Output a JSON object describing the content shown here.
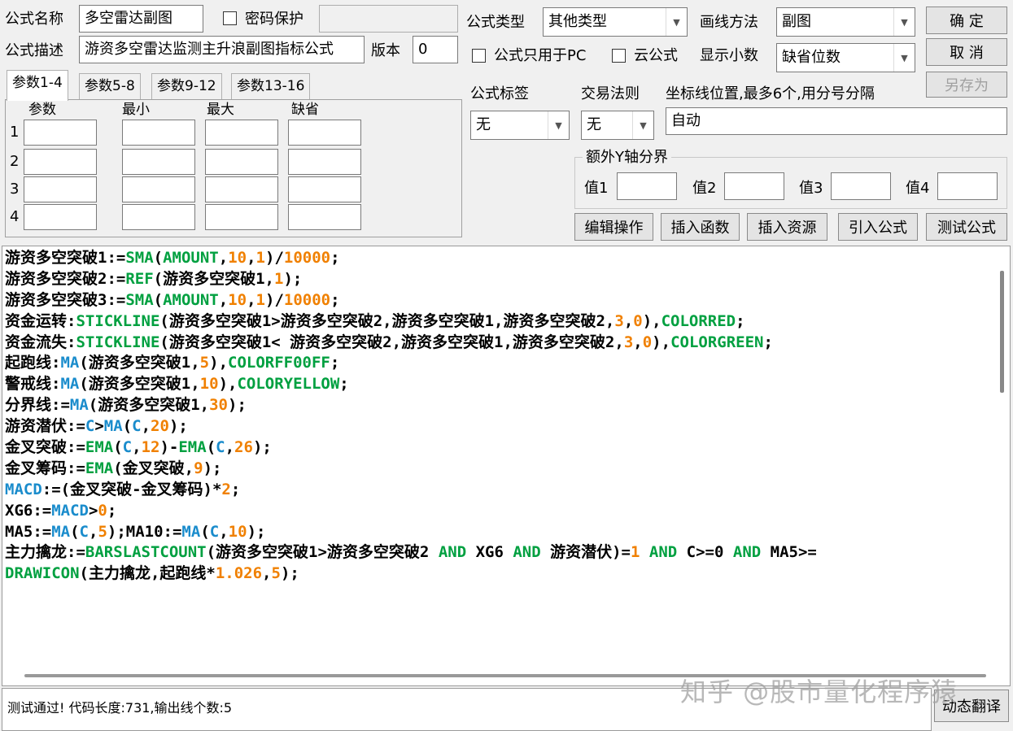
{
  "header": {
    "name_label": "公式名称",
    "name_value": "多空雷达副图",
    "password_label": "密码保护",
    "password_value": "",
    "desc_label": "公式描述",
    "desc_value": "游资多空雷达监测主升浪副图指标公式",
    "version_label": "版本",
    "version_value": "0",
    "type_label": "公式类型",
    "type_value": "其他类型",
    "draw_label": "画线方法",
    "draw_value": "副图",
    "pc_only_label": "公式只用于PC",
    "cloud_label": "云公式",
    "decimal_label": "显示小数",
    "decimal_value": "缺省位数"
  },
  "buttons": {
    "ok": "确  定",
    "cancel": "取  消",
    "save_as": "另存为",
    "edit_ops": "编辑操作",
    "insert_func": "插入函数",
    "insert_res": "插入资源",
    "import_formula": "引入公式",
    "test_formula": "测试公式",
    "dynamic_translate": "动态翻译"
  },
  "tabs": [
    "参数1-4",
    "参数5-8",
    "参数9-12",
    "参数13-16"
  ],
  "params": {
    "headers": [
      "参数",
      "最小",
      "最大",
      "缺省"
    ],
    "rows": [
      "1",
      "2",
      "3",
      "4"
    ]
  },
  "right": {
    "tag_label": "公式标签",
    "tag_value": "无",
    "trade_label": "交易法则",
    "trade_value": "无",
    "axis_label": "坐标线位置,最多6个,用分号分隔",
    "axis_value": "自动",
    "y_group_label": "额外Y轴分界",
    "y_values": [
      "值1",
      "值2",
      "值3",
      "值4"
    ]
  },
  "code_lines": [
    [
      [
        "t",
        "游资多空突破1:="
      ],
      [
        "k",
        "SMA"
      ],
      [
        "t",
        "("
      ],
      [
        "k",
        "AMOUNT"
      ],
      [
        "t",
        ","
      ],
      [
        "n",
        "10"
      ],
      [
        "t",
        ","
      ],
      [
        "n",
        "1"
      ],
      [
        "t",
        ")/"
      ],
      [
        "n",
        "10000"
      ],
      [
        "t",
        ";"
      ]
    ],
    [
      [
        "t",
        "游资多空突破2:="
      ],
      [
        "k",
        "REF"
      ],
      [
        "t",
        "(游资多空突破1,"
      ],
      [
        "n",
        "1"
      ],
      [
        "t",
        ");"
      ]
    ],
    [
      [
        "t",
        "游资多空突破3:="
      ],
      [
        "k",
        "SMA"
      ],
      [
        "t",
        "("
      ],
      [
        "k",
        "AMOUNT"
      ],
      [
        "t",
        ","
      ],
      [
        "n",
        "10"
      ],
      [
        "t",
        ","
      ],
      [
        "n",
        "1"
      ],
      [
        "t",
        ")/"
      ],
      [
        "n",
        "10000"
      ],
      [
        "t",
        ";"
      ]
    ],
    [
      [
        "t",
        "资金运转:"
      ],
      [
        "k",
        "STICKLINE"
      ],
      [
        "t",
        "(游资多空突破1>游资多空突破2,游资多空突破1,游资多空突破2,"
      ],
      [
        "n",
        "3"
      ],
      [
        "t",
        ","
      ],
      [
        "n",
        "0"
      ],
      [
        "t",
        "),"
      ],
      [
        "k",
        "COLORRED"
      ],
      [
        "t",
        ";"
      ]
    ],
    [
      [
        "t",
        "资金流失:"
      ],
      [
        "k",
        "STICKLINE"
      ],
      [
        "t",
        "(游资多空突破1< 游资多空突破2,游资多空突破1,游资多空突破2,"
      ],
      [
        "n",
        "3"
      ],
      [
        "t",
        ","
      ],
      [
        "n",
        "0"
      ],
      [
        "t",
        "),"
      ],
      [
        "k",
        "COLORGREEN"
      ],
      [
        "t",
        ";"
      ]
    ],
    [
      [
        "t",
        "起跑线:"
      ],
      [
        "f",
        "MA"
      ],
      [
        "t",
        "(游资多空突破1,"
      ],
      [
        "n",
        "5"
      ],
      [
        "t",
        "),"
      ],
      [
        "k",
        "COLORFF00FF"
      ],
      [
        "t",
        ";"
      ]
    ],
    [
      [
        "t",
        "警戒线:"
      ],
      [
        "f",
        "MA"
      ],
      [
        "t",
        "(游资多空突破1,"
      ],
      [
        "n",
        "10"
      ],
      [
        "t",
        "),"
      ],
      [
        "k",
        "COLORYELLOW"
      ],
      [
        "t",
        ";"
      ]
    ],
    [
      [
        "t",
        "分界线:="
      ],
      [
        "f",
        "MA"
      ],
      [
        "t",
        "(游资多空突破1,"
      ],
      [
        "n",
        "30"
      ],
      [
        "t",
        ");"
      ]
    ],
    [
      [
        "t",
        "游资潜伏:="
      ],
      [
        "f",
        "C"
      ],
      [
        "t",
        ">"
      ],
      [
        "f",
        "MA"
      ],
      [
        "t",
        "("
      ],
      [
        "f",
        "C"
      ],
      [
        "t",
        ","
      ],
      [
        "n",
        "20"
      ],
      [
        "t",
        ");"
      ]
    ],
    [
      [
        "t",
        "金叉突破:="
      ],
      [
        "k",
        "EMA"
      ],
      [
        "t",
        "("
      ],
      [
        "f",
        "C"
      ],
      [
        "t",
        ","
      ],
      [
        "n",
        "12"
      ],
      [
        "t",
        ")-"
      ],
      [
        "k",
        "EMA"
      ],
      [
        "t",
        "("
      ],
      [
        "f",
        "C"
      ],
      [
        "t",
        ","
      ],
      [
        "n",
        "26"
      ],
      [
        "t",
        ");"
      ]
    ],
    [
      [
        "t",
        "金叉筹码:="
      ],
      [
        "k",
        "EMA"
      ],
      [
        "t",
        "(金叉突破,"
      ],
      [
        "n",
        "9"
      ],
      [
        "t",
        ");"
      ]
    ],
    [
      [
        "f",
        "MACD"
      ],
      [
        "t",
        ":=(金叉突破-金叉筹码)*"
      ],
      [
        "n",
        "2"
      ],
      [
        "t",
        ";"
      ]
    ],
    [
      [
        "t",
        "XG6:="
      ],
      [
        "f",
        "MACD"
      ],
      [
        "t",
        ">"
      ],
      [
        "n",
        "0"
      ],
      [
        "t",
        ";"
      ]
    ],
    [
      [
        "t",
        "MA5:="
      ],
      [
        "f",
        "MA"
      ],
      [
        "t",
        "("
      ],
      [
        "f",
        "C"
      ],
      [
        "t",
        ","
      ],
      [
        "n",
        "5"
      ],
      [
        "t",
        ");MA10:="
      ],
      [
        "f",
        "MA"
      ],
      [
        "t",
        "("
      ],
      [
        "f",
        "C"
      ],
      [
        "t",
        ","
      ],
      [
        "n",
        "10"
      ],
      [
        "t",
        ");"
      ]
    ],
    [
      [
        "t",
        "主力擒龙:="
      ],
      [
        "k",
        "BARSLASTCOUNT"
      ],
      [
        "t",
        "(游资多空突破1>游资多空突破2 "
      ],
      [
        "k",
        "AND"
      ],
      [
        "t",
        " XG6 "
      ],
      [
        "k",
        "AND"
      ],
      [
        "t",
        " 游资潜伏)="
      ],
      [
        "n",
        "1"
      ],
      [
        "t",
        " "
      ],
      [
        "k",
        "AND"
      ],
      [
        "t",
        " C>=0 "
      ],
      [
        "k",
        "AND"
      ],
      [
        "t",
        " MA5>="
      ]
    ],
    [
      [
        "k",
        "DRAWICON"
      ],
      [
        "t",
        "(主力擒龙,起跑线*"
      ],
      [
        "n",
        "1.026"
      ],
      [
        "t",
        ","
      ],
      [
        "n",
        "5"
      ],
      [
        "t",
        ");"
      ]
    ]
  ],
  "status": "测试通过! 代码长度:731,输出线个数:5",
  "watermark": "知乎 @股市量化程序猿"
}
